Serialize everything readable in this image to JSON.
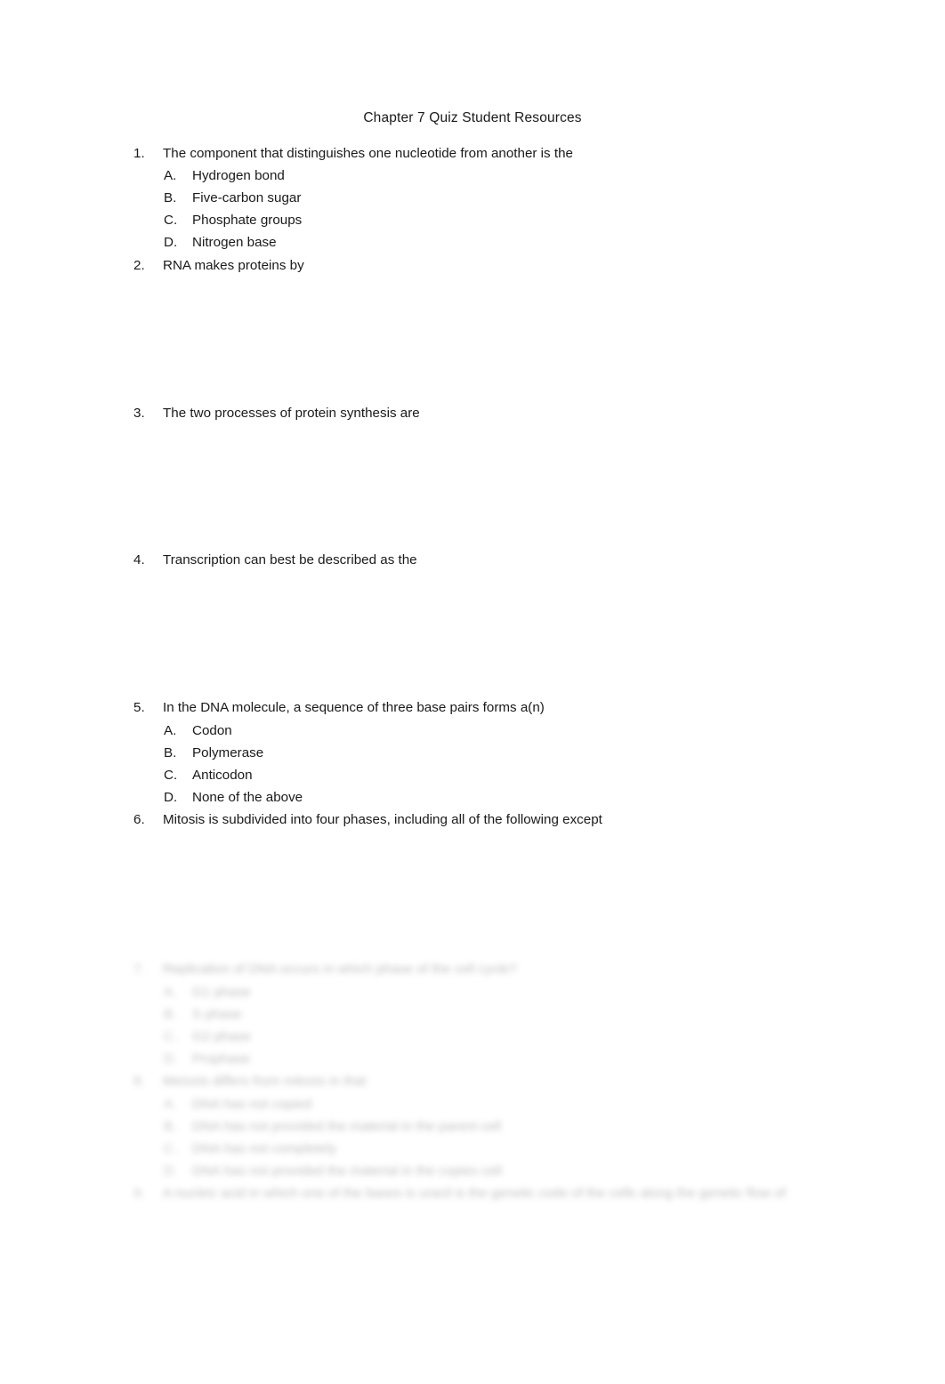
{
  "document": {
    "title": "Chapter 7 Quiz Student Resources",
    "background_color": "#ffffff",
    "text_color": "#1a1a1a",
    "blurred_text_color": "#b9b9b9"
  },
  "questions": [
    {
      "number": "1.",
      "text": "The component that distinguishes one nucleotide from another is the",
      "blurred": false,
      "options": [
        {
          "letter": "A.",
          "text": "Hydrogen bond"
        },
        {
          "letter": "B.",
          "text": "Five-carbon sugar"
        },
        {
          "letter": "C.",
          "text": "Phosphate groups"
        },
        {
          "letter": "D.",
          "text": "Nitrogen base"
        }
      ]
    },
    {
      "number": "2.",
      "text": "RNA makes proteins by",
      "blurred": false,
      "options": []
    },
    {
      "number": "3.",
      "text": "The two processes of protein synthesis are",
      "blurred": false,
      "options": []
    },
    {
      "number": "4.",
      "text": "Transcription can best be described as the",
      "blurred": false,
      "options": []
    },
    {
      "number": "5.",
      "text": "In the DNA molecule, a sequence of three base pairs forms a(n)",
      "blurred": false,
      "options": [
        {
          "letter": "A.",
          "text": "Codon"
        },
        {
          "letter": "B.",
          "text": "Polymerase"
        },
        {
          "letter": "C.",
          "text": "Anticodon"
        },
        {
          "letter": "D.",
          "text": "None of the above"
        }
      ]
    },
    {
      "number": "6.",
      "text": "Mitosis is subdivided into four phases, including all of the following except",
      "blurred": false,
      "options": []
    },
    {
      "number": "7.",
      "text": "Replication of DNA occurs in which phase of the cell cycle?",
      "blurred": true,
      "options": [
        {
          "letter": "A.",
          "text": "G1 phase"
        },
        {
          "letter": "B.",
          "text": "S phase"
        },
        {
          "letter": "C.",
          "text": "G2 phase"
        },
        {
          "letter": "D.",
          "text": "Prophase"
        }
      ]
    },
    {
      "number": "8.",
      "text": "Meiosis differs from mitosis in that",
      "blurred": true,
      "options": [
        {
          "letter": "A.",
          "text": "DNA has not copied"
        },
        {
          "letter": "B.",
          "text": "DNA has not provided the material in the parent cell"
        },
        {
          "letter": "C.",
          "text": "DNA has not completely"
        },
        {
          "letter": "D.",
          "text": "DNA has not provided the material in the copies cell"
        }
      ]
    },
    {
      "number": "9.",
      "text": "A nucleic acid in which one of the bases is uracil is the genetic code of the cells along the genetic flow of",
      "blurred": true,
      "options": []
    }
  ]
}
